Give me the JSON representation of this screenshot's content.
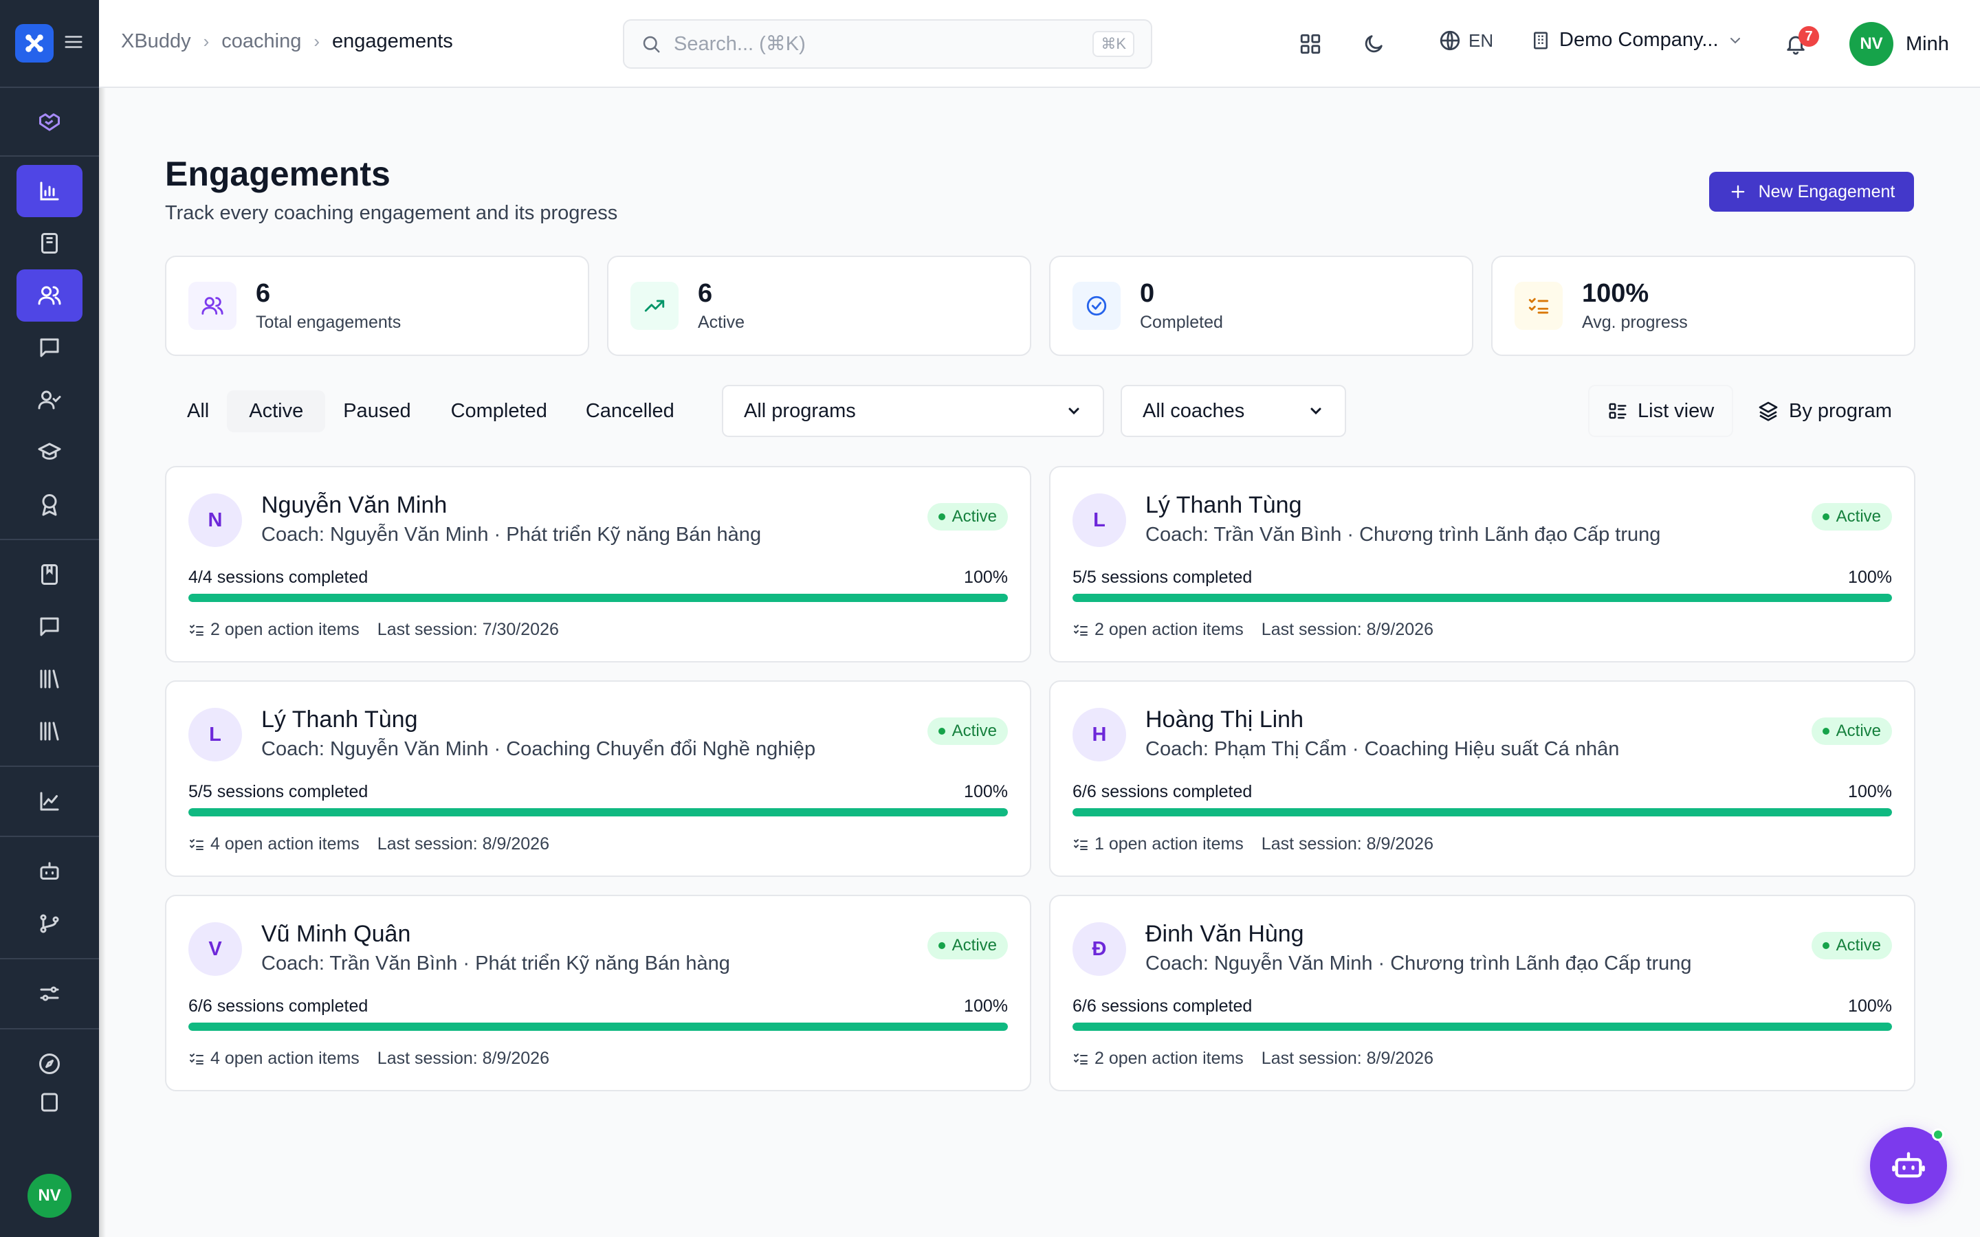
{
  "sidebar": {
    "avatar_initials": "NV"
  },
  "header": {
    "breadcrumb": [
      "XBuddy",
      "coaching",
      "engagements"
    ],
    "search_placeholder": "Search... (⌘K)",
    "search_shortcut": "⌘K",
    "language": "EN",
    "company": "Demo Company...",
    "notification_count": "7",
    "user_initials": "NV",
    "user_name": "Minh"
  },
  "page": {
    "title": "Engagements",
    "subtitle": "Track every coaching engagement and its progress",
    "new_button": "New Engagement"
  },
  "stats": [
    {
      "value": "6",
      "label": "Total engagements",
      "icon": "users-icon",
      "bg": "#f5f3ff",
      "color": "#7c3aed"
    },
    {
      "value": "6",
      "label": "Active",
      "icon": "trending-up-icon",
      "bg": "#ecfdf5",
      "color": "#059669"
    },
    {
      "value": "0",
      "label": "Completed",
      "icon": "check-circle-icon",
      "bg": "#eff6ff",
      "color": "#2563eb"
    },
    {
      "value": "100%",
      "label": "Avg. progress",
      "icon": "list-checks-icon",
      "bg": "#fffbeb",
      "color": "#d97706"
    }
  ],
  "filters": {
    "tabs": [
      "All",
      "Active",
      "Paused",
      "Completed",
      "Cancelled"
    ],
    "active_tab": "Active",
    "program_select": "All programs",
    "coach_select": "All coaches",
    "list_view": "List view",
    "by_program": "By program"
  },
  "engagements": [
    {
      "initial": "N",
      "name": "Nguyễn Văn Minh",
      "coach": "Coach: Nguyễn Văn Minh · Phát triển Kỹ năng Bán hàng",
      "status": "Active",
      "sessions": "4/4 sessions completed",
      "percent": "100%",
      "progress": 1.0,
      "action_items": "2 open action items",
      "last_session": "Last session: 7/30/2026"
    },
    {
      "initial": "L",
      "name": "Lý Thanh Tùng",
      "coach": "Coach: Trần Văn Bình · Chương trình Lãnh đạo Cấp trung",
      "status": "Active",
      "sessions": "5/5 sessions completed",
      "percent": "100%",
      "progress": 1.0,
      "action_items": "2 open action items",
      "last_session": "Last session: 8/9/2026"
    },
    {
      "initial": "L",
      "name": "Lý Thanh Tùng",
      "coach": "Coach: Nguyễn Văn Minh · Coaching Chuyển đổi Nghề nghiệp",
      "status": "Active",
      "sessions": "5/5 sessions completed",
      "percent": "100%",
      "progress": 1.0,
      "action_items": "4 open action items",
      "last_session": "Last session: 8/9/2026"
    },
    {
      "initial": "H",
      "name": "Hoàng Thị Linh",
      "coach": "Coach: Phạm Thị Cẩm · Coaching Hiệu suất Cá nhân",
      "status": "Active",
      "sessions": "6/6 sessions completed",
      "percent": "100%",
      "progress": 1.0,
      "action_items": "1 open action items",
      "last_session": "Last session: 8/9/2026"
    },
    {
      "initial": "V",
      "name": "Vũ Minh Quân",
      "coach": "Coach: Trần Văn Bình · Phát triển Kỹ năng Bán hàng",
      "status": "Active",
      "sessions": "6/6 sessions completed",
      "percent": "100%",
      "progress": 1.0,
      "action_items": "4 open action items",
      "last_session": "Last session: 8/9/2026"
    },
    {
      "initial": "Đ",
      "name": "Đinh Văn Hùng",
      "coach": "Coach: Nguyễn Văn Minh · Chương trình Lãnh đạo Cấp trung",
      "status": "Active",
      "sessions": "6/6 sessions completed",
      "percent": "100%",
      "progress": 1.0,
      "action_items": "2 open action items",
      "last_session": "Last session: 8/9/2026"
    }
  ],
  "colors": {
    "accent": "#4338ca",
    "sidebar": "#1f2937",
    "success": "#10b981",
    "fab": "#7c3aed"
  }
}
